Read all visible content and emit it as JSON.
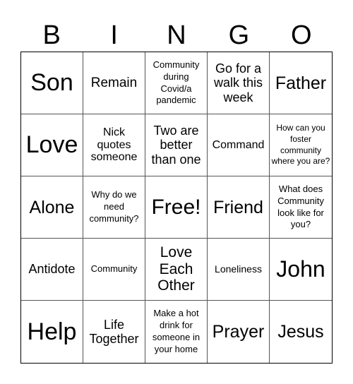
{
  "header": {
    "letters": [
      "B",
      "I",
      "N",
      "G",
      "O"
    ]
  },
  "cells": [
    {
      "text": "Son",
      "col": "B",
      "row": 1
    },
    {
      "text": "Remain",
      "col": "I",
      "row": 1
    },
    {
      "text": "Community during Covid/a pandemic",
      "col": "N",
      "row": 1
    },
    {
      "text": "Go for a walk this week",
      "col": "G",
      "row": 1
    },
    {
      "text": "Father",
      "col": "O",
      "row": 1
    },
    {
      "text": "Love",
      "col": "B",
      "row": 2
    },
    {
      "text": "Nick quotes someone",
      "col": "I",
      "row": 2
    },
    {
      "text": "Two are better than one",
      "col": "N",
      "row": 2
    },
    {
      "text": "Command",
      "col": "G",
      "row": 2
    },
    {
      "text": "How can you foster community where you are?",
      "col": "O",
      "row": 2
    },
    {
      "text": "Alone",
      "col": "B",
      "row": 3
    },
    {
      "text": "Why do we need community?",
      "col": "I",
      "row": 3
    },
    {
      "text": "Free!",
      "col": "N",
      "row": 3,
      "free": true
    },
    {
      "text": "Friend",
      "col": "G",
      "row": 3
    },
    {
      "text": "What does Community look like for you?",
      "col": "O",
      "row": 3
    },
    {
      "text": "Antidote",
      "col": "B",
      "row": 4
    },
    {
      "text": "Community",
      "col": "I",
      "row": 4
    },
    {
      "text": "Love Each Other",
      "col": "N",
      "row": 4
    },
    {
      "text": "Loneliness",
      "col": "G",
      "row": 4
    },
    {
      "text": "John",
      "col": "O",
      "row": 4
    },
    {
      "text": "Help",
      "col": "B",
      "row": 5
    },
    {
      "text": "Life Together",
      "col": "I",
      "row": 5
    },
    {
      "text": "Make a hot drink for someone in your home",
      "col": "N",
      "row": 5
    },
    {
      "text": "Prayer",
      "col": "G",
      "row": 5
    },
    {
      "text": "Jesus",
      "col": "O",
      "row": 5
    }
  ]
}
